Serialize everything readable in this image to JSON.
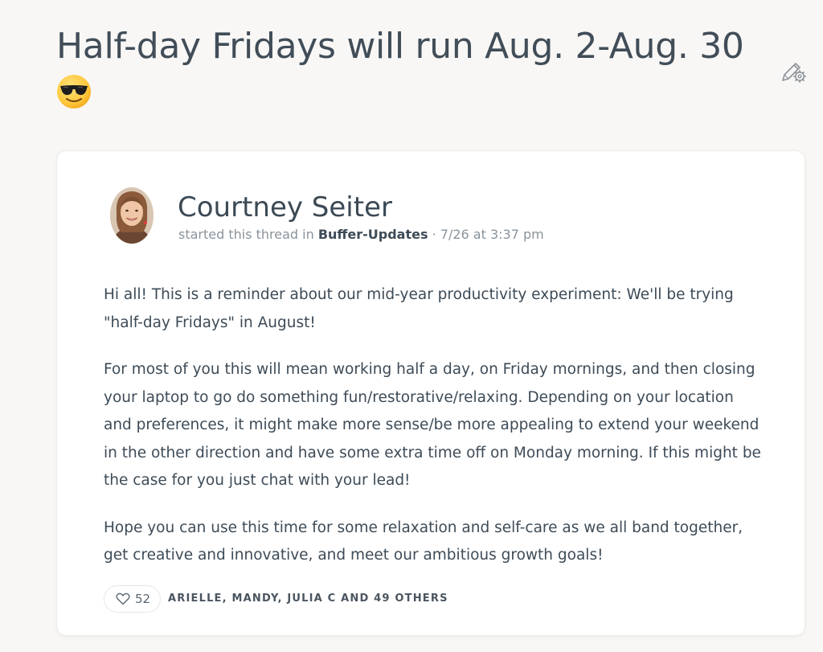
{
  "thread": {
    "title": "Half-day Fridays will run Aug. 2-Aug. 30",
    "title_emoji": "smiling-face-with-sunglasses",
    "edit_icon": "pencil-gear-icon"
  },
  "post": {
    "author": "Courtney Seiter",
    "meta_prefix": "started this thread in",
    "channel": "Buffer-Updates",
    "meta_suffix": "· 7/26 at 3:37 pm",
    "paragraphs": [
      "Hi all! This is a reminder about our mid-year productivity experiment: We'll be trying \"half-day Fridays\" in August!",
      "For most of you this will mean working half a day, on Friday mornings, and then closing your laptop to go do something fun/restorative/relaxing. Depending on your location and preferences, it might make more sense/be more appealing to extend your weekend in the other direction and have some extra time off on Monday morning. If this might be the case for you just chat with your lead!",
      "Hope you can use this time for some relaxation and self-care as we all band together, get creative and innovative, and meet our ambitious growth goals!"
    ],
    "likes": {
      "count": "52",
      "names": "ARIELLE, MANDY, JULIA C AND 49 OTHERS"
    }
  },
  "colors": {
    "background": "#f8f7f5",
    "card": "#ffffff",
    "text": "#3d4b57",
    "muted": "#8a949c"
  }
}
